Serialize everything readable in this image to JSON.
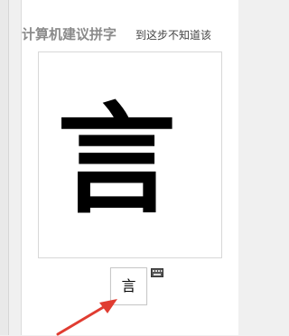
{
  "app": {
    "title": "计算机建议拼字",
    "hint": "到这步不知道该"
  },
  "preview": {
    "character": "言"
  },
  "input": {
    "value": "言"
  },
  "icons": {
    "keyboard": "keyboard-icon",
    "arrow": "red-arrow-annotation"
  },
  "colors": {
    "arrow": "#e03c31",
    "title": "#8a8a8a"
  }
}
